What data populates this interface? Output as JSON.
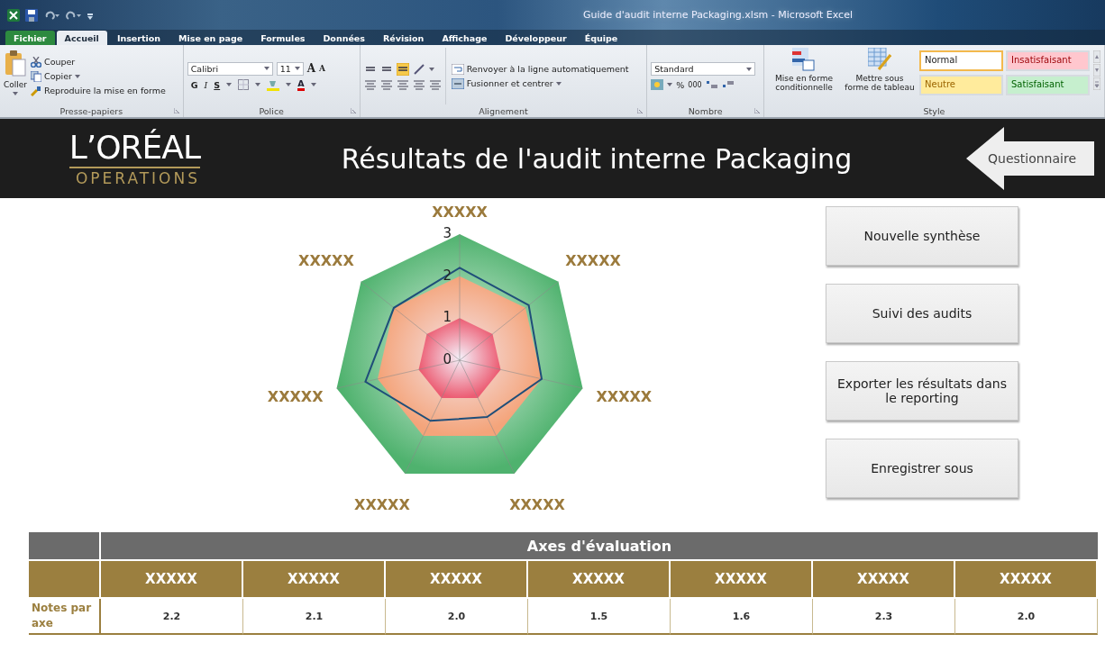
{
  "window": {
    "title": "Guide d'audit interne Packaging.xlsm - Microsoft Excel"
  },
  "ribbon_tabs": [
    {
      "label": "Fichier",
      "kind": "file",
      "selected": false
    },
    {
      "label": "Accueil",
      "kind": "tab",
      "selected": true
    },
    {
      "label": "Insertion",
      "kind": "tab",
      "selected": false
    },
    {
      "label": "Mise en page",
      "kind": "tab",
      "selected": false
    },
    {
      "label": "Formules",
      "kind": "tab",
      "selected": false
    },
    {
      "label": "Données",
      "kind": "tab",
      "selected": false
    },
    {
      "label": "Révision",
      "kind": "tab",
      "selected": false
    },
    {
      "label": "Affichage",
      "kind": "tab",
      "selected": false
    },
    {
      "label": "Développeur",
      "kind": "tab",
      "selected": false
    },
    {
      "label": "Équipe",
      "kind": "tab",
      "selected": false
    }
  ],
  "ribbon": {
    "clipboard": {
      "label": "Presse-papiers",
      "paste": "Coller",
      "cut": "Couper",
      "copy": "Copier",
      "format_painter": "Reproduire la mise en forme"
    },
    "font": {
      "label": "Police",
      "font_name": "Calibri",
      "font_size": "11",
      "grow": "A",
      "shrink": "A",
      "bold": "G",
      "italic": "I",
      "underline": "S",
      "font_color": "A"
    },
    "alignment": {
      "label": "Alignement",
      "wrap_text": "Renvoyer à la ligne automatiquement",
      "merge": "Fusionner et centrer"
    },
    "number": {
      "label": "Nombre",
      "format": "Standard",
      "percent": "%",
      "thousands": "000"
    },
    "styles": {
      "label": "Style",
      "conditional": "Mise en forme conditionnelle",
      "as_table": "Mettre sous forme de tableau",
      "cells": [
        {
          "label": "Normal",
          "kind": "normal",
          "selected": true
        },
        {
          "label": "Insatisfaisant",
          "kind": "bad",
          "selected": false
        },
        {
          "label": "Neutre",
          "kind": "neutral",
          "selected": false
        },
        {
          "label": "Satisfaisant",
          "kind": "good",
          "selected": false
        }
      ]
    }
  },
  "banner": {
    "logo_brand": "L’ORÉAL",
    "logo_division": "OPERATIONS",
    "title": "Résultats de l'audit interne Packaging",
    "back_button": "Questionnaire"
  },
  "radar": {
    "axis_labels": [
      "XXXXX",
      "XXXXX",
      "XXXXX",
      "XXXXX",
      "XXXXX",
      "XXXXX",
      "XXXXX"
    ],
    "tick_labels": [
      "3",
      "2",
      "1",
      "0"
    ]
  },
  "actions": [
    "Nouvelle synthèse",
    "Suivi des audits",
    "Exporter les résultats dans le reporting",
    "Enregistrer sous"
  ],
  "scores": {
    "group_header": "Axes d'évaluation",
    "columns": [
      "XXXXX",
      "XXXXX",
      "XXXXX",
      "XXXXX",
      "XXXXX",
      "XXXXX",
      "XXXXX"
    ],
    "row_label": "Notes par axe",
    "values": [
      "2.2",
      "2.1",
      "2.0",
      "1.5",
      "1.6",
      "2.3",
      "2.0"
    ]
  }
}
